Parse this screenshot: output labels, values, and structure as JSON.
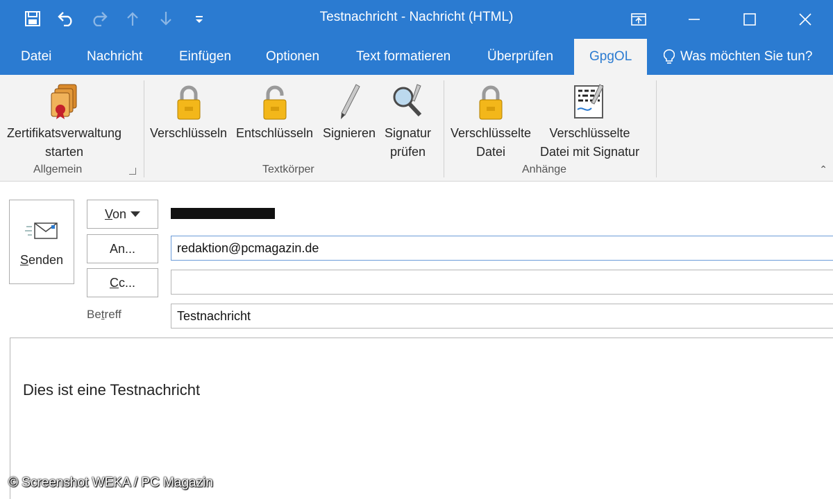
{
  "titlebar": {
    "title": "Testnachricht - Nachricht (HTML)",
    "quick_access": [
      "save-icon",
      "undo-icon",
      "redo-icon",
      "arrow-up-icon",
      "arrow-down-icon",
      "customize-icon"
    ],
    "window_controls": [
      "ribbon-display-icon",
      "minimize-icon",
      "maximize-icon",
      "close-icon"
    ],
    "color": "#2b7bd1"
  },
  "tabs": {
    "items": [
      "Datei",
      "Nachricht",
      "Einfügen",
      "Optionen",
      "Text formatieren",
      "Überprüfen",
      "GpgOL"
    ],
    "active": "GpgOL",
    "tellme": "Was möchten Sie tun?"
  },
  "ribbon": {
    "groups": [
      {
        "label": "Allgemein",
        "buttons": [
          {
            "line1": "Zertifikatsverwaltung",
            "line2": "starten",
            "icon": "certificates-icon"
          }
        ]
      },
      {
        "label": "Textkörper",
        "buttons": [
          {
            "line1": "Verschlüsseln",
            "line2": "",
            "icon": "lock-icon"
          },
          {
            "line1": "Entschlüsseln",
            "line2": "",
            "icon": "unlock-icon"
          },
          {
            "line1": "Signieren",
            "line2": "",
            "icon": "pen-icon"
          },
          {
            "line1": "Signatur",
            "line2": "prüfen",
            "icon": "magnifier-icon"
          }
        ]
      },
      {
        "label": "Anhänge",
        "buttons": [
          {
            "line1": "Verschlüsselte",
            "line2": "Datei",
            "icon": "lock-icon"
          },
          {
            "line1": "Verschlüsselte",
            "line2": "Datei mit Signatur",
            "icon": "signed-document-icon"
          }
        ]
      }
    ]
  },
  "compose": {
    "send_label_first": "S",
    "send_label_rest": "enden",
    "from_label_first": "V",
    "from_label_rest": "on",
    "to_label_first": "A",
    "to_label_rest": "n...",
    "cc_label_first": "C",
    "cc_label_rest": "c...",
    "subject_label_first": "Be",
    "subject_label_u": "t",
    "subject_label_rest": "reff",
    "to_value": "redaktion@pcmagazin.de",
    "cc_value": "",
    "subject_value": "Testnachricht",
    "body_text": "Dies ist eine Testnachricht"
  },
  "credit": "© Screenshot WEKA / PC Magazin"
}
